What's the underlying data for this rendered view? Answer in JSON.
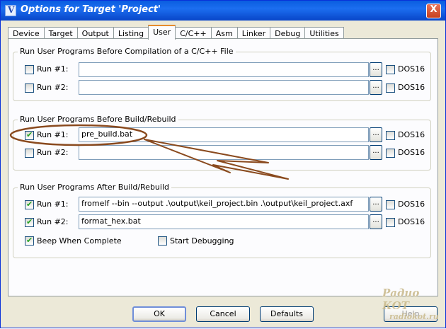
{
  "window": {
    "title": "Options for Target 'Project'",
    "close_glyph": "X"
  },
  "tabs": [
    {
      "label": "Device"
    },
    {
      "label": "Target"
    },
    {
      "label": "Output"
    },
    {
      "label": "Listing"
    },
    {
      "label": "User",
      "active": true
    },
    {
      "label": "C/C++"
    },
    {
      "label": "Asm"
    },
    {
      "label": "Linker"
    },
    {
      "label": "Debug"
    },
    {
      "label": "Utilities"
    }
  ],
  "groups": {
    "before_compile": {
      "title": "Run User Programs Before Compilation of a C/C++ File",
      "rows": [
        {
          "label": "Run #1:",
          "checked": false,
          "value": "",
          "dos16": false
        },
        {
          "label": "Run #2:",
          "checked": false,
          "value": "",
          "dos16": false
        }
      ]
    },
    "before_build": {
      "title": "Run User Programs Before Build/Rebuild",
      "rows": [
        {
          "label": "Run #1:",
          "checked": true,
          "value": "pre_build.bat",
          "dos16": false
        },
        {
          "label": "Run #2:",
          "checked": false,
          "value": "",
          "dos16": false
        }
      ]
    },
    "after_build": {
      "title": "Run User Programs After Build/Rebuild",
      "rows": [
        {
          "label": "Run #1:",
          "checked": true,
          "value": "fromelf --bin --output .\\output\\keil_project.bin .\\output\\keil_project.axf",
          "dos16": false
        },
        {
          "label": "Run #2:",
          "checked": true,
          "value": "format_hex.bat",
          "dos16": false
        }
      ],
      "beep_label": "Beep When Complete",
      "beep_checked": true,
      "debug_label": "Start Debugging",
      "debug_checked": false
    }
  },
  "browse_label": "...",
  "dos16_label": "DOS16",
  "buttons": {
    "ok": "OK",
    "cancel": "Cancel",
    "defaults": "Defaults",
    "help": "Help"
  },
  "watermark": {
    "line1": "Радио КОТ",
    "line2": "radiokot.ru"
  },
  "colors": {
    "annotation": "#8a4a1e",
    "title_bar": "#0a5ddf"
  }
}
